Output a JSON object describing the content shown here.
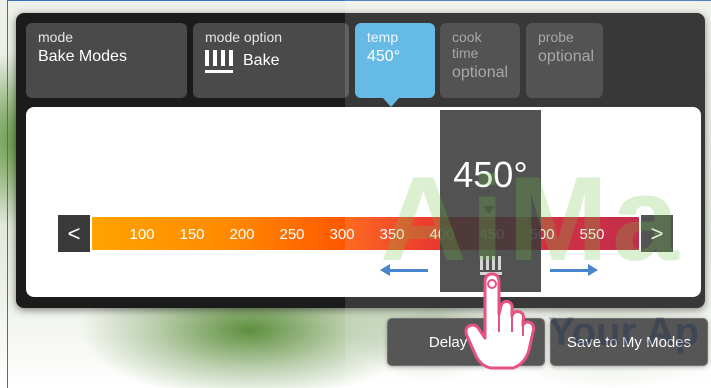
{
  "tabs": [
    {
      "label": "mode",
      "value": "Bake Modes"
    },
    {
      "label": "mode option",
      "value": "Bake"
    },
    {
      "label": "temp",
      "value": "450°"
    },
    {
      "label": "cook time",
      "value": "optional"
    },
    {
      "label": "probe",
      "value": "optional"
    }
  ],
  "slider": {
    "ticks": [
      "100",
      "150",
      "200",
      "250",
      "300",
      "350",
      "400",
      "450",
      "500",
      "550"
    ],
    "selected_value": "450°",
    "prev_icon": "<",
    "next_icon": ">"
  },
  "buttons": {
    "delay_start": "Delay Start",
    "save_modes": "Save to My Modes"
  },
  "watermark": {
    "main": "AiMa",
    "sub": "Your Ap"
  },
  "colors": {
    "active_tab": "#4fb1e3",
    "panel": "#1b1b1b",
    "swipe_arrow": "#2f73c5"
  }
}
